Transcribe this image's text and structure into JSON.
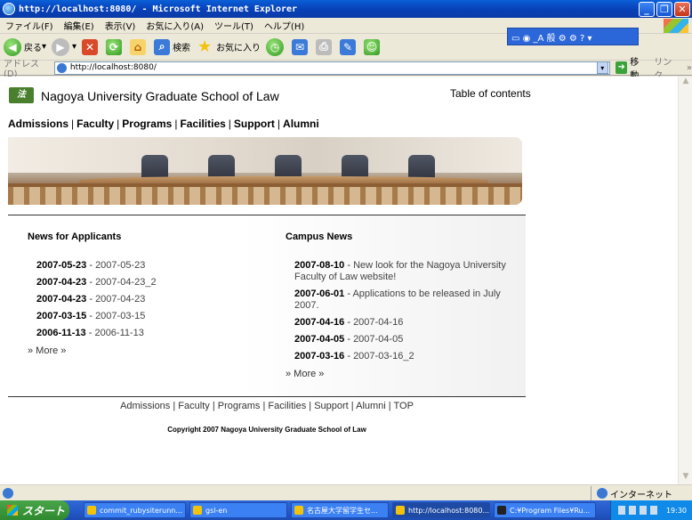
{
  "window": {
    "title": "http://localhost:8080/ - Microsoft Internet Explorer"
  },
  "menu": [
    "ファイル(F)",
    "編集(E)",
    "表示(V)",
    "お気に入り(A)",
    "ツール(T)",
    "ヘルプ(H)"
  ],
  "toolbar": {
    "back": "戻る",
    "search": "検索",
    "favorites": "お気に入り"
  },
  "address": {
    "label": "アドレス(D)",
    "url": "http://localhost:8080/",
    "go": "移動",
    "links": "リンク"
  },
  "site": {
    "title": "Nagoya University Graduate School of Law",
    "toc": "Table of contents",
    "nav": [
      "Admissions",
      "Faculty",
      "Programs",
      "Facilities",
      "Support",
      "Alumni"
    ]
  },
  "news_applicants": {
    "heading": "News for Applicants",
    "items": [
      {
        "date": "2007-05-23",
        "title": "2007-05-23"
      },
      {
        "date": "2007-04-23",
        "title": "2007-04-23_2"
      },
      {
        "date": "2007-04-23",
        "title": "2007-04-23"
      },
      {
        "date": "2007-03-15",
        "title": "2007-03-15"
      },
      {
        "date": "2006-11-13",
        "title": "2006-11-13"
      }
    ],
    "more": "» More »"
  },
  "campus_news": {
    "heading": "Campus News",
    "items": [
      {
        "date": "2007-08-10",
        "title": "New look for the Nagoya University Faculty of Law website!"
      },
      {
        "date": "2007-06-01",
        "title": "Applications to be released in July 2007."
      },
      {
        "date": "2007-04-16",
        "title": "2007-04-16"
      },
      {
        "date": "2007-04-05",
        "title": "2007-04-05"
      },
      {
        "date": "2007-03-16",
        "title": "2007-03-16_2"
      }
    ],
    "more": "» More »"
  },
  "footer": {
    "nav": [
      "Admissions",
      "Faculty",
      "Programs",
      "Facilities",
      "Support",
      "Alumni",
      "TOP"
    ],
    "copyright": "Copyright 2007 Nagoya University Graduate School of Law"
  },
  "status": {
    "zone": "インターネット"
  },
  "taskbar": {
    "start": "スタート",
    "tasks": [
      "commit_rubysiterunn...",
      "gsl-en",
      "名古屋大学留学生セ...",
      "http://localhost:8080...",
      "C:¥Program Files¥Ru..."
    ],
    "time": "19:30"
  }
}
